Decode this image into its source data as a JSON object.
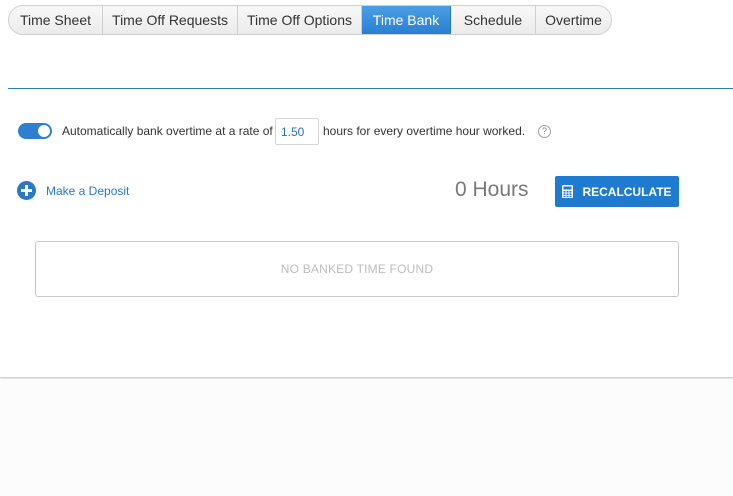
{
  "tabs": [
    {
      "label": "Time Sheet",
      "active": false
    },
    {
      "label": "Time Off Requests",
      "active": false
    },
    {
      "label": "Time Off Options",
      "active": false
    },
    {
      "label": "Time Bank",
      "active": true
    },
    {
      "label": "Schedule",
      "active": false
    },
    {
      "label": "Overtime",
      "active": false
    }
  ],
  "auto_bank": {
    "enabled": true,
    "label_before": "Automatically bank overtime at a rate of",
    "rate_value": "1.50",
    "label_after": "hours for every overtime hour worked.",
    "help_symbol": "?"
  },
  "deposit": {
    "link_label": "Make a Deposit",
    "icon": "plus-circle-icon"
  },
  "balance": {
    "hours_label": "0 Hours"
  },
  "recalculate": {
    "label": "RECALCULATE",
    "icon": "calculator-icon"
  },
  "empty_state": {
    "message": "NO BANKED TIME FOUND"
  },
  "colors": {
    "accent": "#1f7bd0",
    "active_tab": "#3a8fdc",
    "divider": "#2f7dc0",
    "empty_text": "#bdbdbd"
  }
}
